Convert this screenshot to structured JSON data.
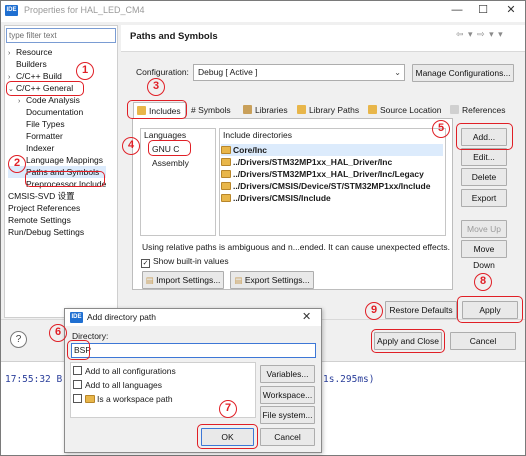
{
  "window": {
    "title": "Properties for HAL_LED_CM4",
    "app_icon": "IDE",
    "controls": [
      "—",
      "☐",
      "✕"
    ]
  },
  "left": {
    "filter_placeholder": "type filter text",
    "items": [
      {
        "label": "Resource",
        "twisty": "›"
      },
      {
        "label": "Builders",
        "twisty": ""
      },
      {
        "label": "C/C++ Build",
        "twisty": "›"
      },
      {
        "label": "C/C++ General",
        "twisty": "⌄"
      },
      {
        "label": "Code Analysis",
        "twisty": "›"
      },
      {
        "label": "Documentation",
        "twisty": ""
      },
      {
        "label": "File Types",
        "twisty": ""
      },
      {
        "label": "Formatter",
        "twisty": ""
      },
      {
        "label": "Indexer",
        "twisty": ""
      },
      {
        "label": "Language Mappings",
        "twisty": ""
      },
      {
        "label": "Paths and Symbols",
        "twisty": ""
      },
      {
        "label": "Preprocessor Include",
        "twisty": ""
      },
      {
        "label": "CMSIS-SVD 设置",
        "twisty": ""
      },
      {
        "label": "Project References",
        "twisty": ""
      },
      {
        "label": "Remote Settings",
        "twisty": ""
      },
      {
        "label": "Run/Debug Settings",
        "twisty": ""
      }
    ]
  },
  "header": {
    "title": "Paths and Symbols",
    "nav": "⇦ ▾ ⇨ ▾ ▾"
  },
  "config": {
    "label": "Configuration:",
    "value": "Debug  [ Active ]",
    "manage_button": "Manage Configurations..."
  },
  "tabs": [
    {
      "label": "Includes",
      "color": "#e8b64a"
    },
    {
      "label": "# Symbols",
      "color": ""
    },
    {
      "label": "Libraries",
      "color": "#c9a05a"
    },
    {
      "label": "Library Paths",
      "color": "#e8b64a"
    },
    {
      "label": "Source Location",
      "color": "#e8b64a"
    },
    {
      "label": "References",
      "color": "#d0d0d0"
    }
  ],
  "languages": {
    "header": "Languages",
    "items": [
      "GNU C",
      "Assembly"
    ]
  },
  "include_dirs": {
    "header": "Include directories",
    "items": [
      "Core/Inc",
      "../Drivers/STM32MP1xx_HAL_Driver/Inc",
      "../Drivers/STM32MP1xx_HAL_Driver/Inc/Legacy",
      "../Drivers/CMSIS/Device/ST/STM32MP1xx/Include",
      "../Drivers/CMSIS/Include"
    ]
  },
  "side_buttons": {
    "add": "Add...",
    "edit": "Edit...",
    "delete": "Delete",
    "export": "Export",
    "move_up": "Move Up",
    "move_down": "Move Down"
  },
  "notice": "Using relative paths is ambiguous and n...ended. It can cause unexpected effects.",
  "show_builtin": "Show built-in values",
  "import_settings": "Import Settings...",
  "export_settings": "Export Settings...",
  "restore_defaults": "Restore Defaults",
  "apply": "Apply",
  "apply_and_close": "Apply and Close",
  "cancel": "Cancel",
  "help": "?",
  "console": {
    "left": "17:55:32 B",
    "right": "1s.295ms)"
  },
  "dialog": {
    "title": "Add directory path",
    "directory_label": "Directory:",
    "directory_value": "BSP",
    "opt_all_configs": "Add to all configurations",
    "opt_all_langs": "Add to all languages",
    "opt_workspace": "Is a workspace path",
    "variables": "Variables...",
    "workspace": "Workspace...",
    "file_system": "File system...",
    "ok": "OK",
    "cancel": "Cancel"
  },
  "annotations": [
    "1",
    "2",
    "3",
    "4",
    "5",
    "6",
    "7",
    "8",
    "9"
  ],
  "colors": {
    "annotation_red": "#e01f26",
    "focus_blue": "#3d77d6",
    "folder_yellow": "#e8b64a"
  }
}
